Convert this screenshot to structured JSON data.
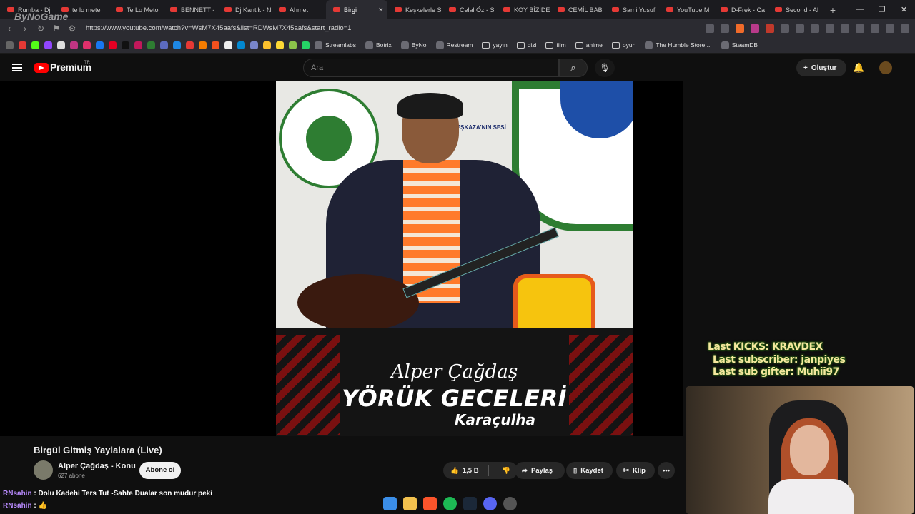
{
  "browser": {
    "tabs": [
      {
        "label": "Rumba - Dj"
      },
      {
        "label": "te lo mete"
      },
      {
        "label": "Te Lo Meto"
      },
      {
        "label": "BENNETT -"
      },
      {
        "label": "Dj Kantik - N"
      },
      {
        "label": "Ahmet"
      },
      {
        "label": "Birgi"
      },
      {
        "label": "Keşkelerle S"
      },
      {
        "label": "Celal Öz - S"
      },
      {
        "label": "KOY BİZİDE"
      },
      {
        "label": "CEMİL BAB"
      },
      {
        "label": "Sami Yusuf"
      },
      {
        "label": "YouTube M"
      },
      {
        "label": "D-Frek - Ca"
      },
      {
        "label": "Second - Al"
      }
    ],
    "url": "https://www.youtube.com/watch?v=WsM7X45aafs&list=RDWsM7X45aafs&start_radio=1",
    "bookmarks": [
      {
        "label": "Streamlabs"
      },
      {
        "label": "Botrix"
      },
      {
        "label": "ByNo"
      },
      {
        "label": "Restream"
      },
      {
        "label": "yayın",
        "folder": true
      },
      {
        "label": "dizi",
        "folder": true
      },
      {
        "label": "film",
        "folder": true
      },
      {
        "label": "anime",
        "folder": true
      },
      {
        "label": "oyun",
        "folder": true
      },
      {
        "label": "The Humble Store:..."
      },
      {
        "label": "SteamDB"
      }
    ],
    "watermark": "ByNoGame"
  },
  "youtube": {
    "brand": "Premium",
    "region": "TR",
    "search_placeholder": "Ara",
    "create_label": "Oluştur",
    "video_title": "Birgül Gitmiş Yaylalara (Live)",
    "channel_name": "Alper Çağdaş - Konu",
    "subscribers": "627 abone",
    "subscribe_label": "Abone ol",
    "like_count": "1,5 B",
    "share_label": "Paylaş",
    "save_label": "Kaydet",
    "clip_label": "Klip",
    "thumbnail": {
      "artist": "Alper Çağdaş",
      "title": "YÖRÜK GECELERİ",
      "place": "Karaçulha",
      "logo_text": "BEŞKAZA'NIN SESİ"
    }
  },
  "stream_overlay": {
    "last_kicks": "Last KICKS: KRAVDEX",
    "last_subscriber": "Last subscriber: janpiyes",
    "last_sub_gifter": "Last sub gifter: Muhii97"
  },
  "chat": [
    {
      "user": "RNsahin",
      "message": "Dolu Kadehi Ters Tut -Sahte Dualar son mudur peki"
    },
    {
      "user": "RNsahin",
      "message": "👍"
    }
  ],
  "colors": {
    "accent": "#ff0000",
    "overlay_text": "#f5e79e",
    "chat_user": "#b98bff"
  }
}
